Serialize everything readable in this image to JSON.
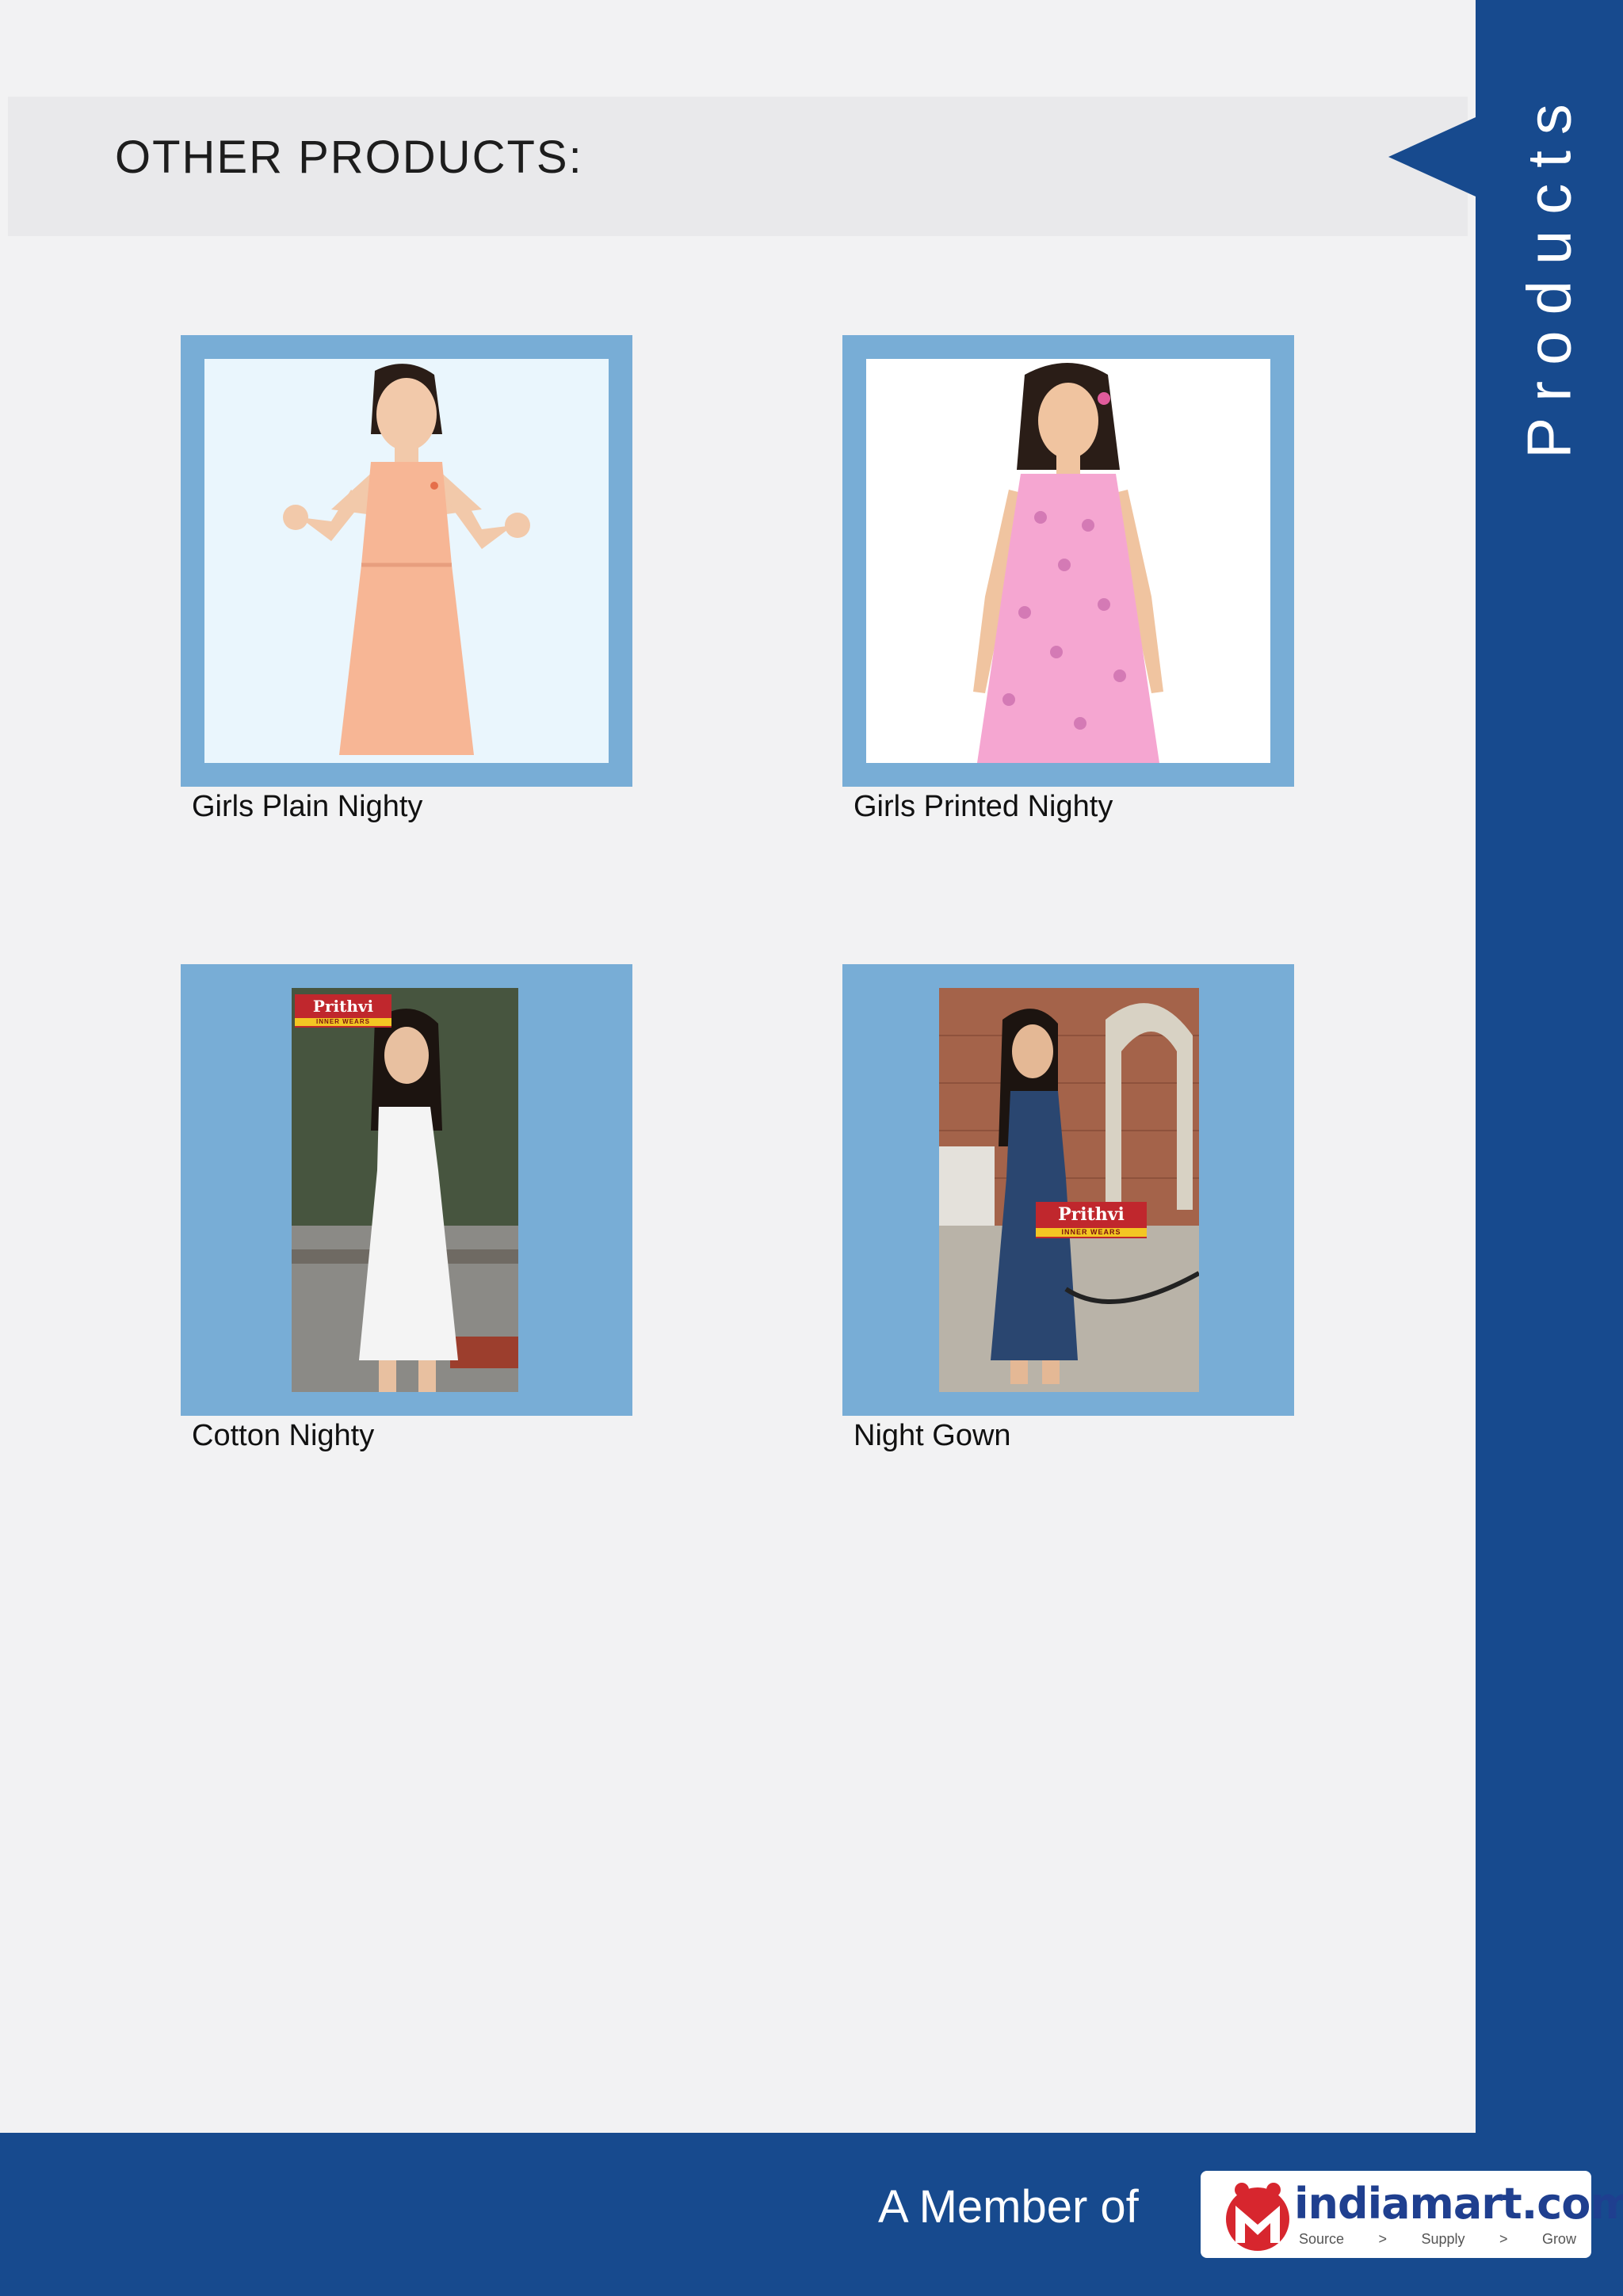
{
  "header": {
    "title": "OTHER PRODUCTS:"
  },
  "sidebar": {
    "label": "Products"
  },
  "products": [
    {
      "caption": "Girls Plain Nighty"
    },
    {
      "caption": "Girls Printed Nighty"
    },
    {
      "caption": "Cotton Nighty",
      "brand": "Prithvi",
      "brand_sub": "INNER WEARS"
    },
    {
      "caption": "Night Gown",
      "brand": "Prithvi",
      "brand_sub": "INNER WEARS"
    }
  ],
  "footer": {
    "member_text": "A Member of",
    "logo_text": "indiamart.com",
    "logo_tagline": [
      "Source",
      ">",
      "Supply",
      ">",
      "Grow"
    ]
  },
  "colors": {
    "sidebar": "#174a8e",
    "card_frame": "#78add6",
    "page_background": "#f2f2f3"
  }
}
